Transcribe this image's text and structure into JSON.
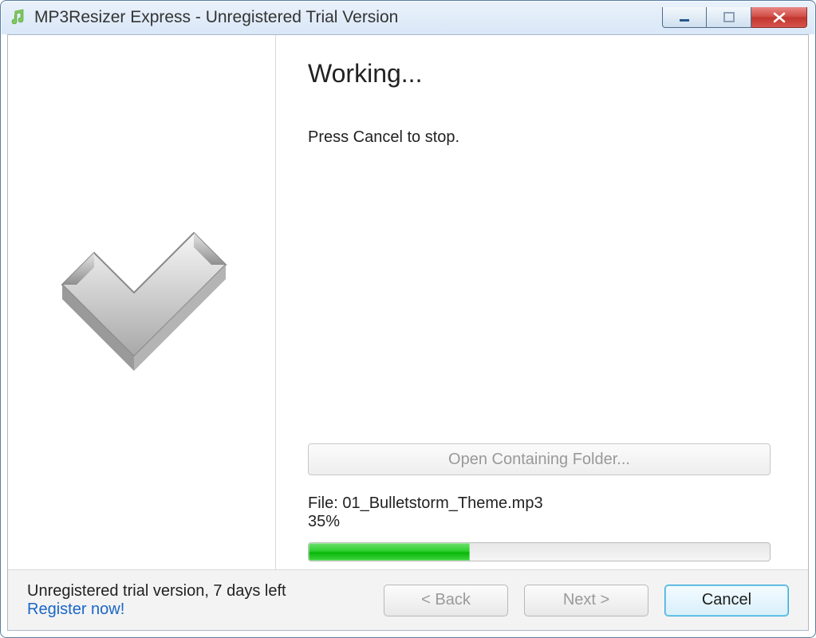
{
  "window": {
    "title": "MP3Resizer Express - Unregistered Trial Version"
  },
  "main": {
    "heading": "Working...",
    "instruction": "Press Cancel to stop.",
    "open_folder_label": "Open Containing Folder...",
    "file_prefix": "File: ",
    "file_name": "01_Bulletstorm_Theme.mp3",
    "percent_text": "35%",
    "progress_value": 35
  },
  "footer": {
    "trial_text": "Unregistered trial version, 7 days left",
    "register_label": "Register now!",
    "back_label": "< Back",
    "next_label": "Next >",
    "cancel_label": "Cancel"
  },
  "icons": {
    "app": "music-note-icon",
    "left_graphic": "checkmark-icon"
  },
  "colors": {
    "progress_green": "#2fcf2f",
    "link_blue": "#1a66c7",
    "close_red": "#cf4c44"
  }
}
